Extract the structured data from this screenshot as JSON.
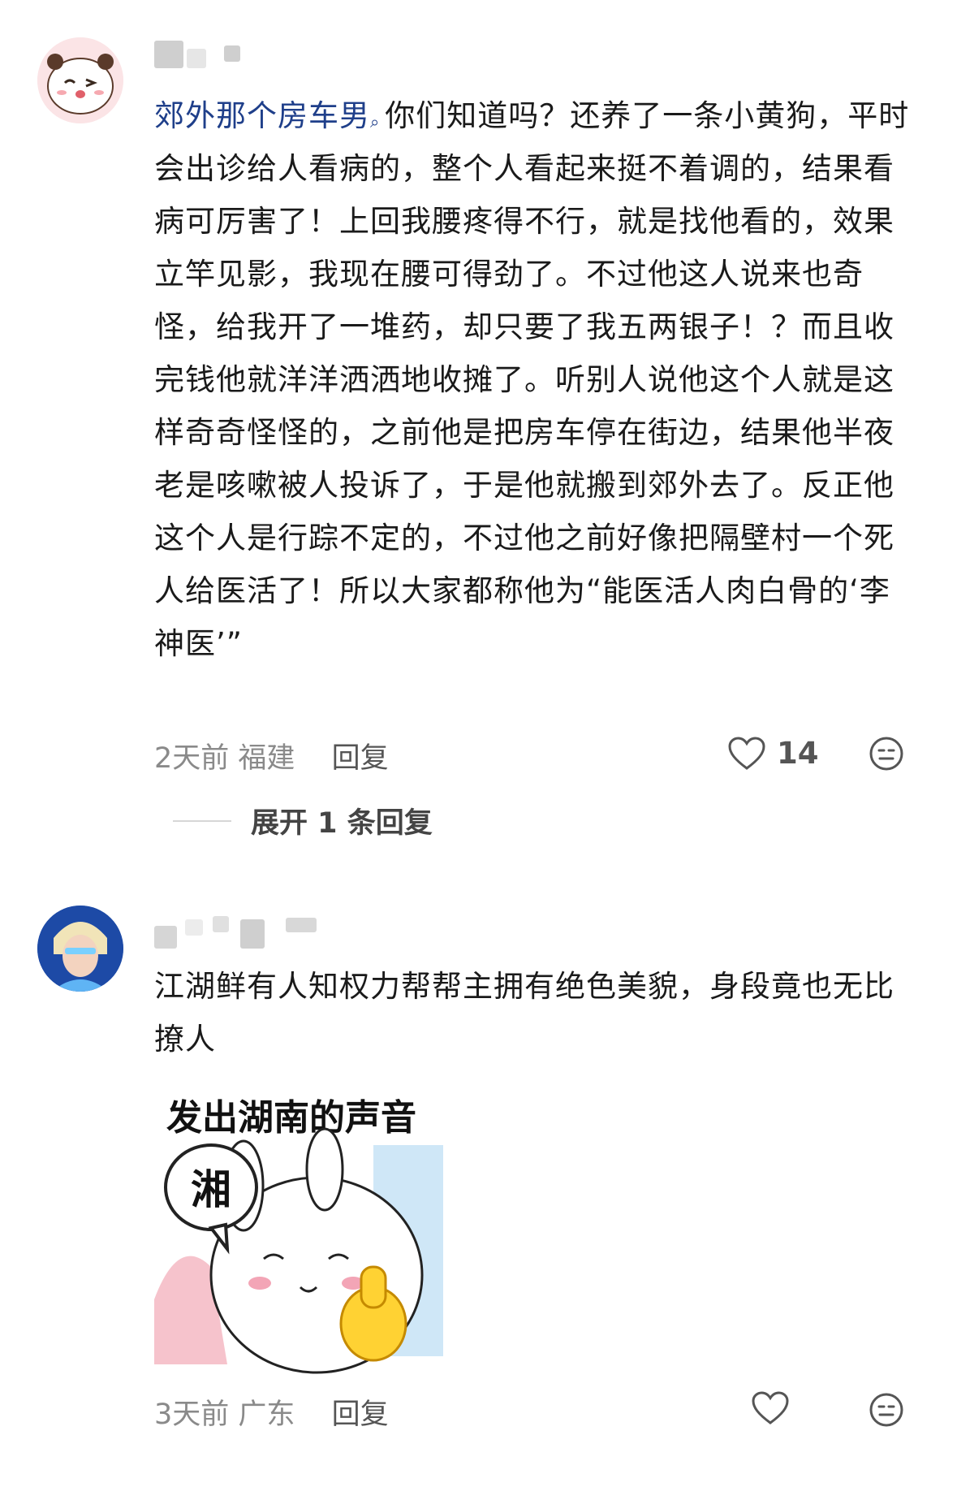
{
  "comments": [
    {
      "mention": "郊外那个房车男",
      "text": "你们知道吗？还养了一条小黄狗，平时会出诊给人看病的，整个人看起来挺不着调的，结果看病可厉害了！上回我腰疼得不行，就是找他看的，效果立竿见影，我现在腰可得劲了。不过他这人说来也奇怪，给我开了一堆药，却只要了我五两银子！？而且收完钱他就洋洋洒洒地收摊了。听别人说他这个人就是这样奇奇怪怪的，之前他是把房车停在街边，结果他半夜老是咳嗽被人投诉了，于是他就搬到郊外去了。反正他这个人是行踪不定的，不过他之前好像把隔壁村一个死人给医活了！所以大家都称他为“能医活人肉白骨的‘李神医’”",
      "time": "2天前",
      "location": "福建",
      "reply_label": "回复",
      "likes": "14",
      "expand_label": "展开 1 条回复"
    },
    {
      "text": "江湖鲜有人知权力帮帮主拥有绝色美貌，身段竟也无比撩人",
      "time": "3天前",
      "location": "广东",
      "reply_label": "回复",
      "likes": "",
      "sticker": {
        "caption": "发出湖南的声音",
        "bubble": "湘"
      }
    }
  ],
  "colors": {
    "mention": "#1f3f8a",
    "meta": "#8a8a8a",
    "text": "#1a1a1a"
  },
  "icons": {
    "mention_marker": "search-icon",
    "like": "heart-outline-icon",
    "reaction": "neutral-face-icon"
  }
}
